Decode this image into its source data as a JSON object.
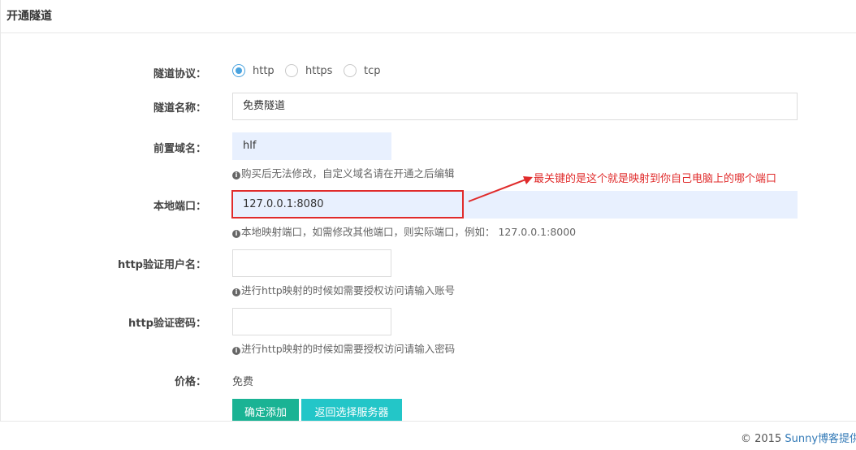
{
  "header": {
    "title": "开通隧道"
  },
  "form": {
    "protocol": {
      "label": "隧道协议：",
      "options": [
        {
          "label": "http",
          "checked": true
        },
        {
          "label": "https",
          "checked": false
        },
        {
          "label": "tcp",
          "checked": false
        }
      ]
    },
    "name": {
      "label": "隧道名称：",
      "value": "免费隧道"
    },
    "domain": {
      "label": "前置域名：",
      "value": "hlf",
      "help": "购买后无法修改，自定义域名请在开通之后编辑"
    },
    "local_port": {
      "label": "本地端口：",
      "value": "127.0.0.1:8080",
      "help": "本地映射端口，如需修改其他端口，则实际端口，例如： 127.0.0.1:8000"
    },
    "http_user": {
      "label": "http验证用户名：",
      "value": "",
      "help": "进行http映射的时候如需要授权访问请输入账号"
    },
    "http_pass": {
      "label": "http验证密码：",
      "value": "",
      "help": "进行http映射的时候如需要授权访问请输入密码"
    },
    "price": {
      "label": "价格：",
      "value": "免费"
    },
    "buttons": {
      "confirm": "确定添加",
      "back": "返回选择服务器"
    }
  },
  "annotation": {
    "text": "最关键的是这个就是映射到你自己电脑上的哪个端口"
  },
  "footer": {
    "copyright": "© 2015",
    "brand": "Sunny博客提供技"
  },
  "colors": {
    "accent_blue": "#4aa3df",
    "confirm_button": "#1ab394",
    "back_button": "#23c6c8",
    "annotation_red": "#e02b2b",
    "autofill_bg": "#e8f0fe"
  },
  "icons": {
    "help": "info-circle-icon"
  }
}
